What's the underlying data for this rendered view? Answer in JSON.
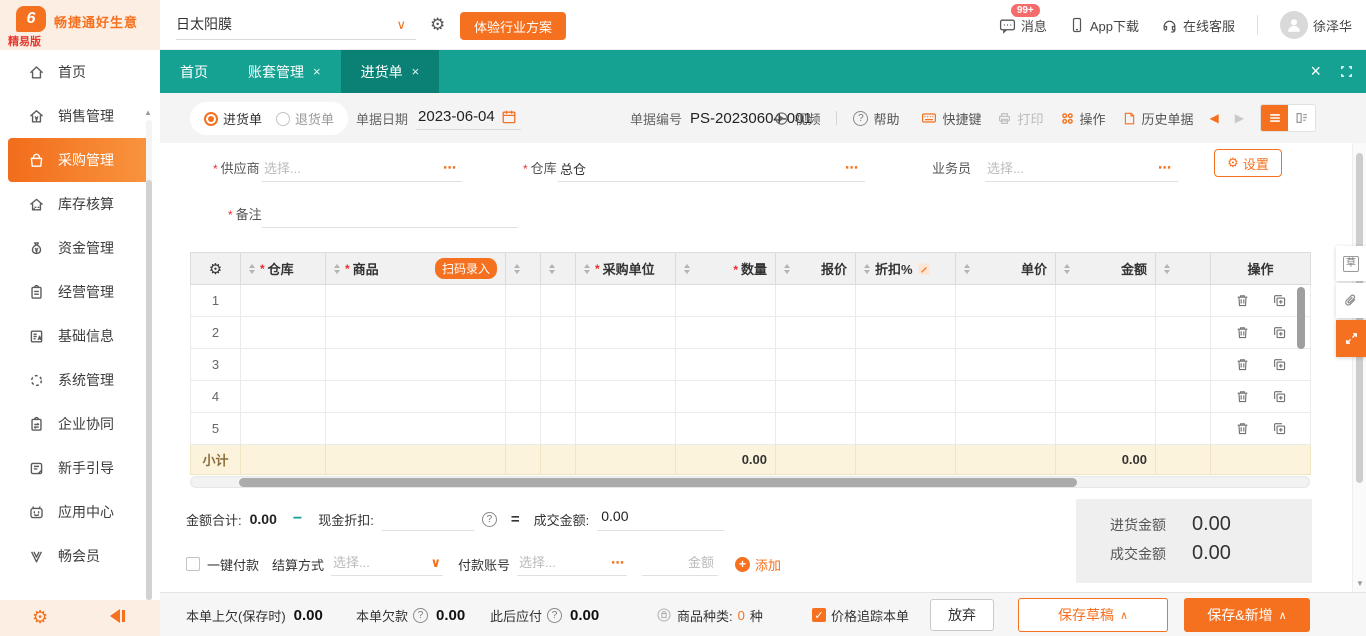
{
  "glyphs": {
    "logo": "6",
    "close": "×",
    "dots": "⋯",
    "chevron_down": "∨",
    "caret_left": "◀",
    "caret_right": "▶",
    "plus": "+",
    "check": "✓",
    "question": "?",
    "gear": "⚙",
    "caret_up": "∧",
    "minus": "−",
    "equals": "=",
    "asterisk": "*",
    "scroll_up": "▲",
    "scroll_down": "▼",
    "draft": "草"
  },
  "topbar": {
    "brand": "畅捷通好生意",
    "edition": "精易版",
    "account": "日太阳膜",
    "trial_button": "体验行业方案",
    "messages": "消息",
    "messages_badge": "99+",
    "app_download": "App下载",
    "online_service": "在线客服",
    "username": "徐泽华"
  },
  "sidebar": {
    "items": [
      {
        "label": "首页"
      },
      {
        "label": "销售管理"
      },
      {
        "label": "采购管理"
      },
      {
        "label": "库存核算"
      },
      {
        "label": "资金管理"
      },
      {
        "label": "经营管理"
      },
      {
        "label": "基础信息"
      },
      {
        "label": "系统管理"
      },
      {
        "label": "企业协同"
      },
      {
        "label": "新手引导"
      },
      {
        "label": "应用中心"
      },
      {
        "label": "畅会员"
      }
    ]
  },
  "tabs": [
    {
      "label": "首页"
    },
    {
      "label": "账套管理"
    },
    {
      "label": "进货单"
    }
  ],
  "toolbar": {
    "radio_purchase": "进货单",
    "radio_return": "退货单",
    "date_label": "单据日期",
    "date_value": "2023-06-04",
    "number_label": "单据编号",
    "number_value": "PS-20230604-001",
    "video": "视频",
    "help": "帮助",
    "shortcuts": "快捷键",
    "print": "打印",
    "actions": "操作",
    "history": "历史单据"
  },
  "form": {
    "supplier_label": "供应商",
    "supplier_placeholder": "选择...",
    "warehouse_label": "仓库",
    "warehouse_value": "总仓",
    "salesman_label": "业务员",
    "salesman_placeholder": "选择...",
    "settings_button": "设置",
    "remark_label": "备注"
  },
  "table": {
    "col_warehouse": "仓库",
    "col_product": "商品",
    "scan_badge": "扫码录入",
    "col_unit": "采购单位",
    "col_qty": "数量",
    "col_quote": "报价",
    "col_discount": "折扣%",
    "col_price": "单价",
    "col_amount": "金额",
    "col_ops": "操作",
    "row_numbers": [
      "1",
      "2",
      "3",
      "4",
      "5"
    ],
    "subtotal_label": "小计",
    "subtotal_qty": "0.00",
    "subtotal_amount": "0.00"
  },
  "totals": {
    "amount_total_label": "金额合计:",
    "amount_total_value": "0.00",
    "cash_discount_label": "现金折扣:",
    "deal_label": "成交金额:",
    "deal_value": "0.00"
  },
  "payment": {
    "onekey_label": "一键付款",
    "settle_label": "结算方式",
    "settle_placeholder": "选择...",
    "account_label": "付款账号",
    "account_placeholder": "选择...",
    "amount_placeholder": "金额",
    "add_label": "添加"
  },
  "summary": {
    "purchase_label": "进货金额",
    "purchase_value": "0.00",
    "deal_label": "成交金额",
    "deal_value": "0.00"
  },
  "bottombar": {
    "owed_label": "本单上欠(保存时)",
    "owed_value": "0.00",
    "debt_label": "本单欠款",
    "debt_value": "0.00",
    "payable_label": "此后应付",
    "payable_value": "0.00",
    "sku_label": "商品种类:",
    "sku_value": "0",
    "sku_unit": "种",
    "price_track_label": "价格追踪本单",
    "abandon": "放弃",
    "save_draft": "保存草稿",
    "save_new": "保存&新增"
  }
}
